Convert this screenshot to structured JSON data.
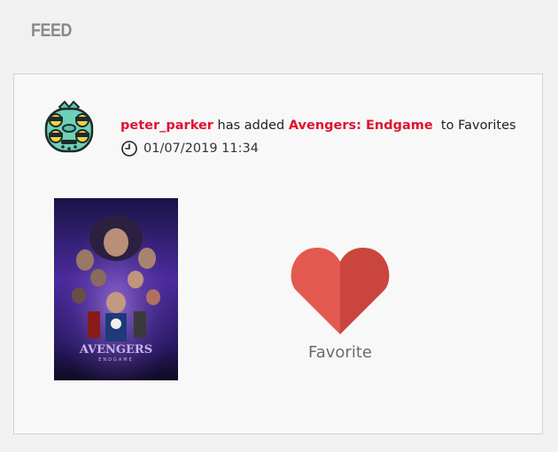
{
  "header": {
    "title": "FEED"
  },
  "feed_item": {
    "user": "peter_parker",
    "action": "has added",
    "movie": "Avengers: Endgame",
    "suffix": "to Favorites",
    "timestamp": "01/07/2019 11:34",
    "poster": {
      "brand_text": "AVENGERS",
      "sub_text": "ENDGAME"
    },
    "reaction": {
      "label": "Favorite",
      "icon": "heart-icon"
    }
  },
  "colors": {
    "accent": "#e0132f",
    "heart_left": "#e4594f",
    "heart_right": "#c9453d",
    "label": "#6b6b6b"
  }
}
